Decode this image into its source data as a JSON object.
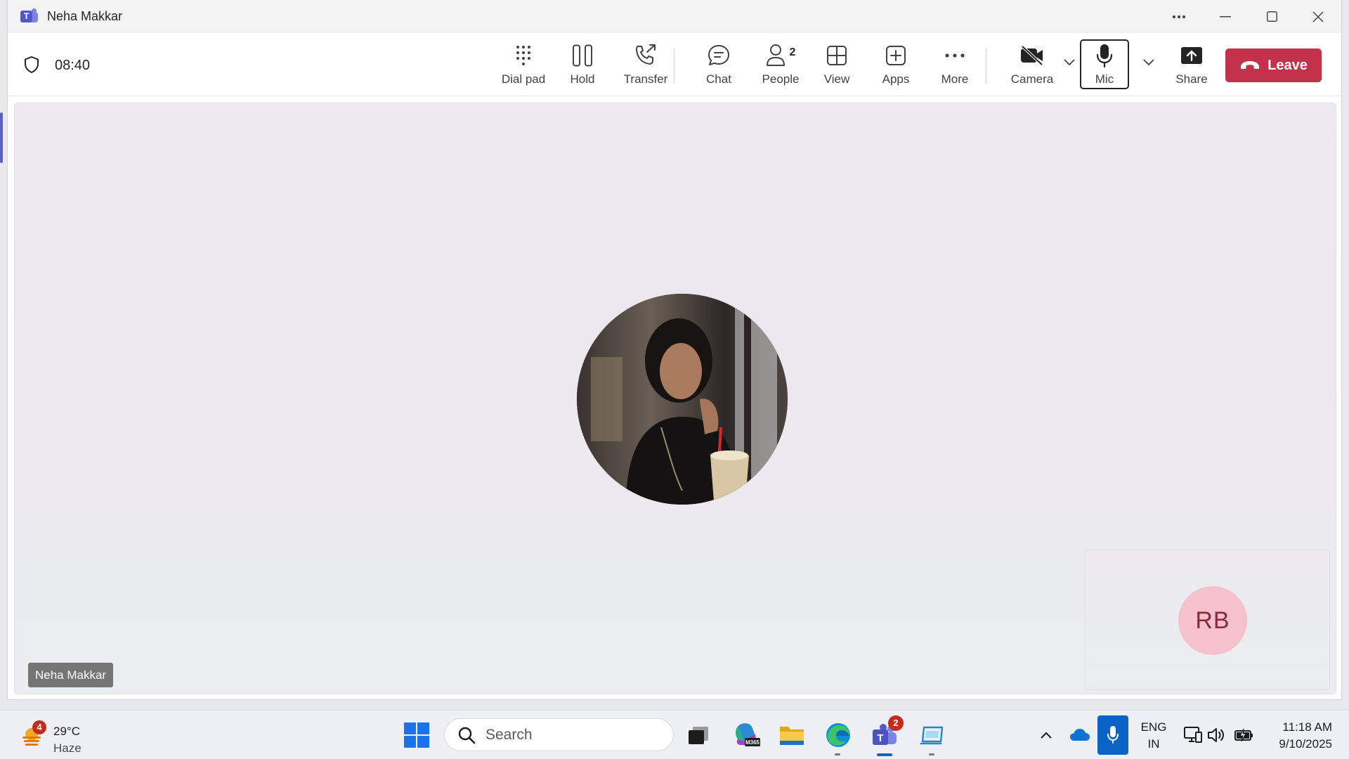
{
  "window": {
    "title": "Neha Makkar",
    "controls": {
      "more": "···",
      "minimize": "—",
      "maximize": "☐",
      "close": "✕"
    }
  },
  "call": {
    "timer": "08:40",
    "icons": {
      "security": "shield-icon"
    }
  },
  "toolbar": {
    "dialpad_label": "Dial pad",
    "hold_label": "Hold",
    "transfer_label": "Transfer",
    "chat_label": "Chat",
    "people_label": "People",
    "people_count": "2",
    "view_label": "View",
    "apps_label": "Apps",
    "more_label": "More",
    "camera_label": "Camera",
    "mic_label": "Mic",
    "share_label": "Share",
    "leave_label": "Leave",
    "colors": {
      "leave": "#c4314b",
      "brand": "#5b5fc7"
    }
  },
  "stage": {
    "main_participant": {
      "name": "Neha Makkar",
      "has_photo": true
    },
    "self_view": {
      "initials": "RB"
    }
  },
  "taskbar": {
    "weather": {
      "badge": "4",
      "temp": "29°C",
      "condition": "Haze"
    },
    "search_placeholder": "Search",
    "apps": [
      {
        "name": "task-view-icon"
      },
      {
        "name": "m365-icon",
        "label": "M365"
      },
      {
        "name": "file-explorer-icon"
      },
      {
        "name": "edge-icon"
      },
      {
        "name": "teams-icon",
        "badge": "2"
      },
      {
        "name": "snipping-icon"
      }
    ],
    "tray": {
      "lang_line1": "ENG",
      "lang_line2": "IN",
      "time": "11:18 AM",
      "date": "9/10/2025"
    }
  }
}
